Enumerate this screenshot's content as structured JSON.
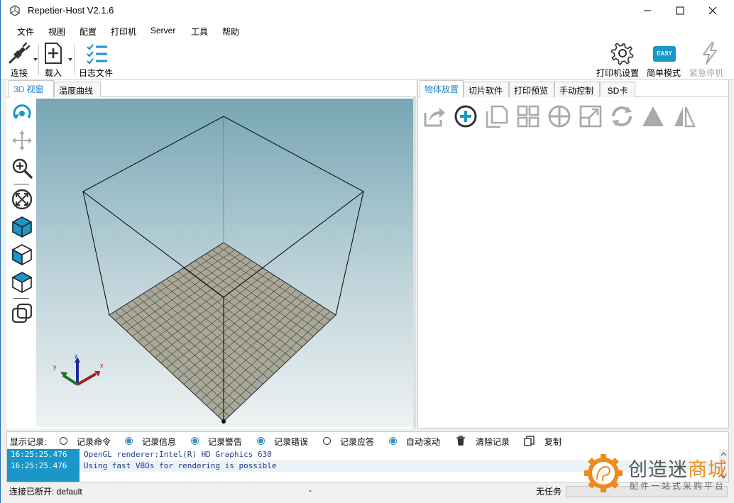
{
  "window": {
    "title": "Repetier-Host V2.1.6",
    "accent_color": "#1a96c8"
  },
  "menu": [
    "文件",
    "视图",
    "配置",
    "打印机",
    "Server",
    "工具",
    "帮助"
  ],
  "toolbar": {
    "connect_label": "连接",
    "load_label": "载入",
    "log_label": "日志文件",
    "printer_settings_label": "打印机设置",
    "easy_mode_label": "简单模式",
    "easy_badge": "EASY",
    "emergency_stop_label": "紧急停机"
  },
  "left_tabs": [
    "3D 视窗",
    "温度曲线"
  ],
  "right_tabs": [
    "物体放置",
    "切片软件",
    "打印预览",
    "手动控制",
    "SD卡"
  ],
  "side_tools": [
    "rotate-icon",
    "move-icon",
    "zoom-icon",
    "fit-view-icon",
    "iso-view-icon",
    "front-view-icon",
    "top-view-icon",
    "parallel-projection-icon"
  ],
  "object_tools": [
    "export-icon",
    "add-object-icon",
    "copy-icon",
    "autoposition-icon",
    "center-icon",
    "scale-icon",
    "rotate-object-icon",
    "cut-icon",
    "mirror-icon"
  ],
  "log": {
    "filters_label": "显示记录:",
    "filters": [
      {
        "label": "记录命令",
        "checked": false
      },
      {
        "label": "记录信息",
        "checked": true
      },
      {
        "label": "记录警告",
        "checked": true
      },
      {
        "label": "记录错误",
        "checked": true
      },
      {
        "label": "记录应答",
        "checked": false
      },
      {
        "label": "自动滚动",
        "checked": true
      }
    ],
    "clear_label": "清除记录",
    "copy_label": "复制",
    "entries": [
      {
        "time": "16:25:25.476",
        "message": "OpenGL renderer:Intel(R) HD Graphics 630"
      },
      {
        "time": "16:25:25.476",
        "message": "Using fast VBOs for rendering is possible"
      }
    ]
  },
  "status": {
    "connection": "连接已断开: default",
    "middle": "-",
    "task": "无任务"
  },
  "watermark": {
    "name_part1": "创造迷",
    "name_part2": "商城",
    "slogan": "配件一站式采购平台"
  }
}
